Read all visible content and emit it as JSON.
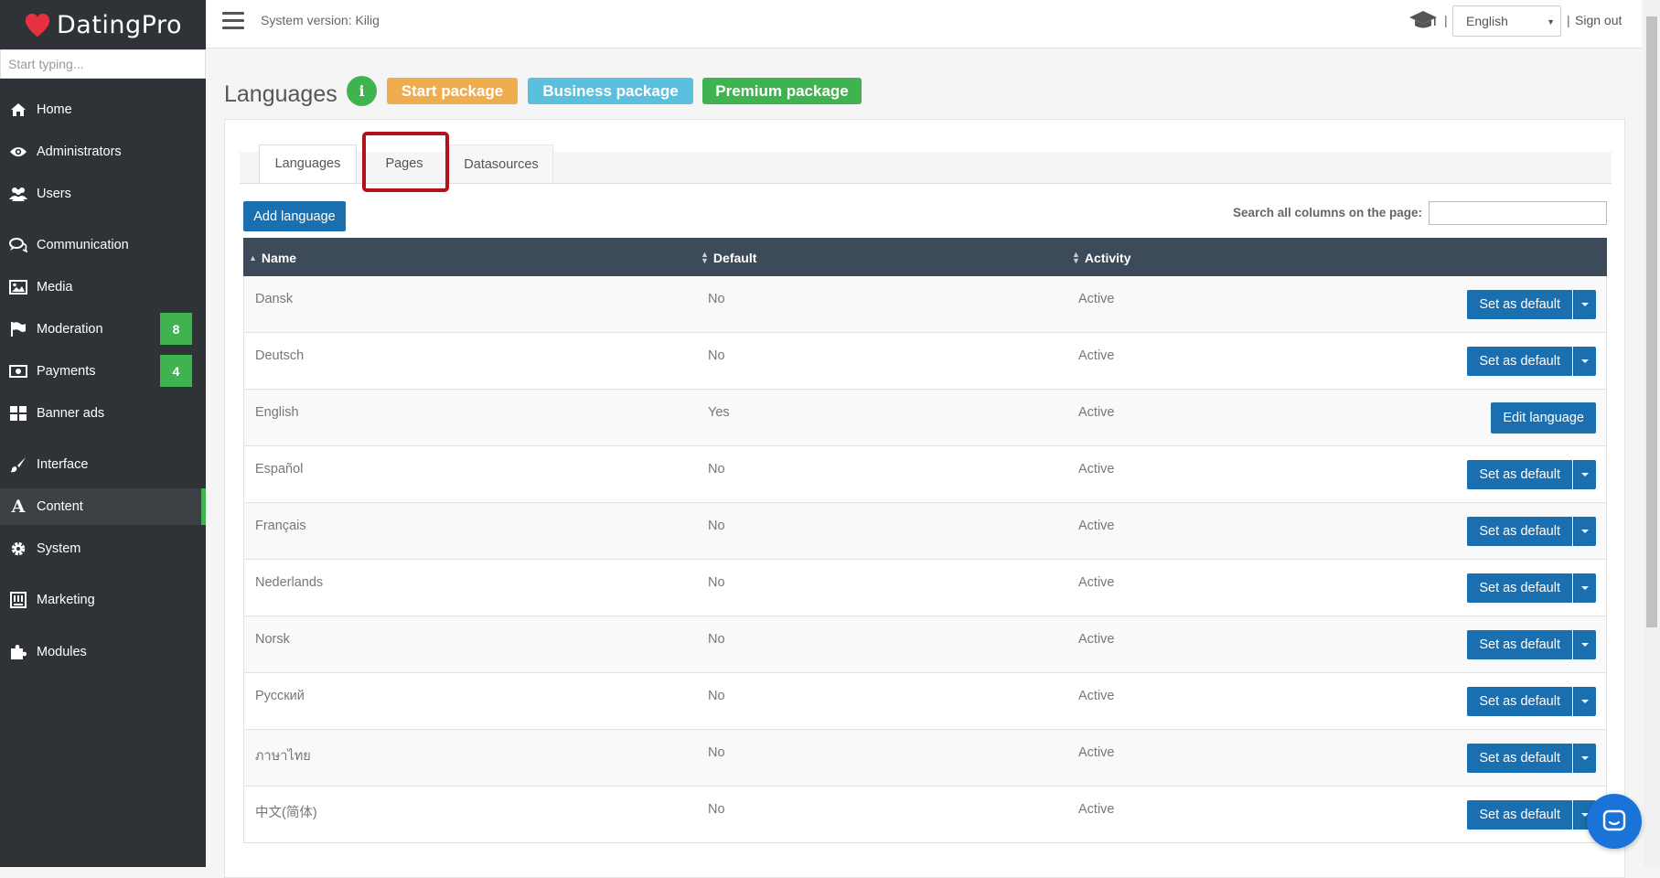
{
  "brand": {
    "name": "DatingPro",
    "heart_color": "#e8313f"
  },
  "sidebar": {
    "search_placeholder": "Start typing...",
    "items": [
      {
        "label": "Home",
        "icon": "home-icon"
      },
      {
        "label": "Administrators",
        "icon": "eye-icon"
      },
      {
        "label": "Users",
        "icon": "users-icon"
      },
      {
        "label": "Communication",
        "icon": "chat-icon"
      },
      {
        "label": "Media",
        "icon": "image-icon"
      },
      {
        "label": "Moderation",
        "icon": "flag-icon",
        "badge": "8"
      },
      {
        "label": "Payments",
        "icon": "money-icon",
        "badge": "4"
      },
      {
        "label": "Banner ads",
        "icon": "grid-icon"
      },
      {
        "label": "Interface",
        "icon": "brush-icon"
      },
      {
        "label": "Content",
        "icon": "font-icon",
        "active": true
      },
      {
        "label": "System",
        "icon": "gear-icon"
      },
      {
        "label": "Marketing",
        "icon": "marketing-icon"
      },
      {
        "label": "Modules",
        "icon": "puzzle-icon"
      }
    ]
  },
  "topbar": {
    "system_version": "System version: Kilig",
    "separator": "|",
    "language": "English",
    "sign_out": "Sign out"
  },
  "page": {
    "title": "Languages",
    "info_label": "i",
    "packages": {
      "start": "Start package",
      "business": "Business package",
      "premium": "Premium package"
    },
    "tabs": [
      "Languages",
      "Pages",
      "Datasources"
    ],
    "add_button": "Add language",
    "search_label": "Search all columns on the page:"
  },
  "table": {
    "headers": [
      "Name",
      "Default",
      "Activity"
    ],
    "set_default_label": "Set as default",
    "edit_label": "Edit language",
    "rows": [
      {
        "name": "Dansk",
        "default": "No",
        "activity": "Active"
      },
      {
        "name": "Deutsch",
        "default": "No",
        "activity": "Active"
      },
      {
        "name": "English",
        "default": "Yes",
        "activity": "Active"
      },
      {
        "name": "Español",
        "default": "No",
        "activity": "Active"
      },
      {
        "name": "Français",
        "default": "No",
        "activity": "Active"
      },
      {
        "name": "Nederlands",
        "default": "No",
        "activity": "Active"
      },
      {
        "name": "Norsk",
        "default": "No",
        "activity": "Active"
      },
      {
        "name": "Русский",
        "default": "No",
        "activity": "Active"
      },
      {
        "name": "ภาษาไทย",
        "default": "No",
        "activity": "Active"
      },
      {
        "name": "中文(简体)",
        "default": "No",
        "activity": "Active"
      }
    ]
  },
  "colors": {
    "accent": "#1a6fb0",
    "green": "#3fb34f",
    "highlight": "#b3111c"
  }
}
